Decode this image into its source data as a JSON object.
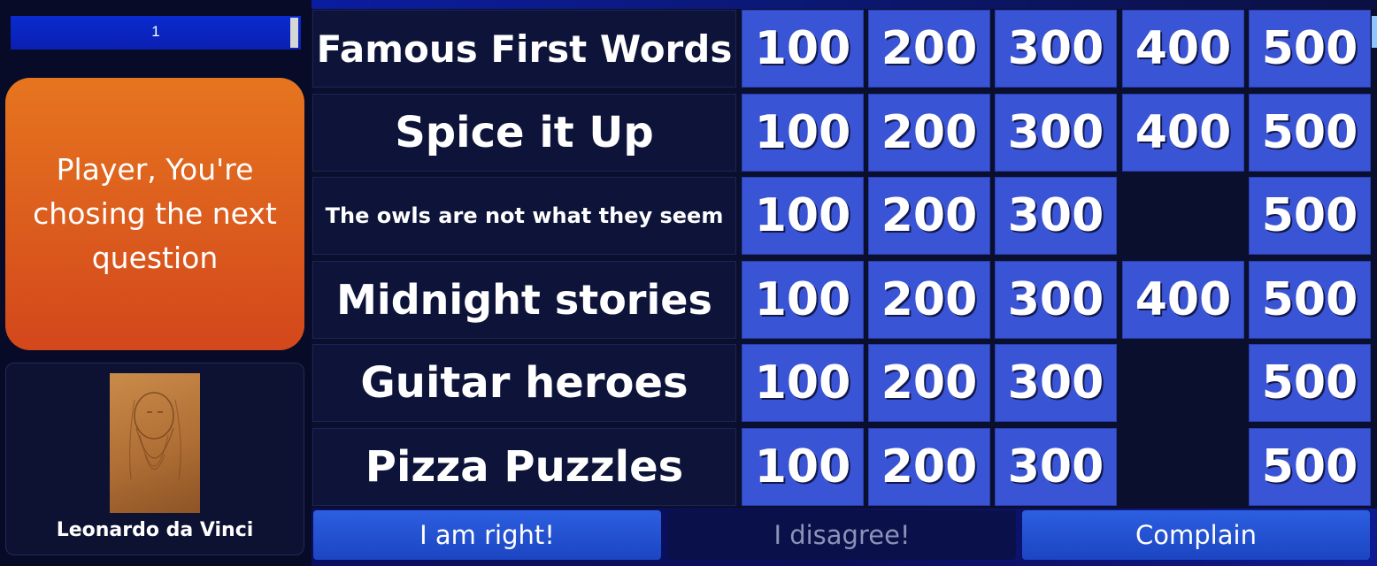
{
  "progress": {
    "value": "1"
  },
  "turn_message": "Player, You're chosing the next question",
  "player": {
    "name": "Leonardo da Vinci"
  },
  "board": {
    "categories": [
      {
        "name": "Famous First Words",
        "values": [
          "100",
          "200",
          "300",
          "400",
          "500"
        ]
      },
      {
        "name": "Spice it Up",
        "values": [
          "100",
          "200",
          "300",
          "400",
          "500"
        ]
      },
      {
        "name": "The owls are not what they seem",
        "values": [
          "100",
          "200",
          "300",
          "",
          "500"
        ]
      },
      {
        "name": "Midnight stories",
        "values": [
          "100",
          "200",
          "300",
          "400",
          "500"
        ]
      },
      {
        "name": "Guitar heroes",
        "values": [
          "100",
          "200",
          "300",
          "",
          "500"
        ]
      },
      {
        "name": "Pizza Puzzles",
        "values": [
          "100",
          "200",
          "300",
          "",
          "500"
        ]
      }
    ]
  },
  "buttons": {
    "right": "I am right!",
    "disagree": "I disagree!",
    "complain": "Complain"
  },
  "colors": {
    "tile": "#3a54d6",
    "turn_card_top": "#e6751f",
    "turn_card_bottom": "#d3471c",
    "background": "#0b0f2e"
  }
}
